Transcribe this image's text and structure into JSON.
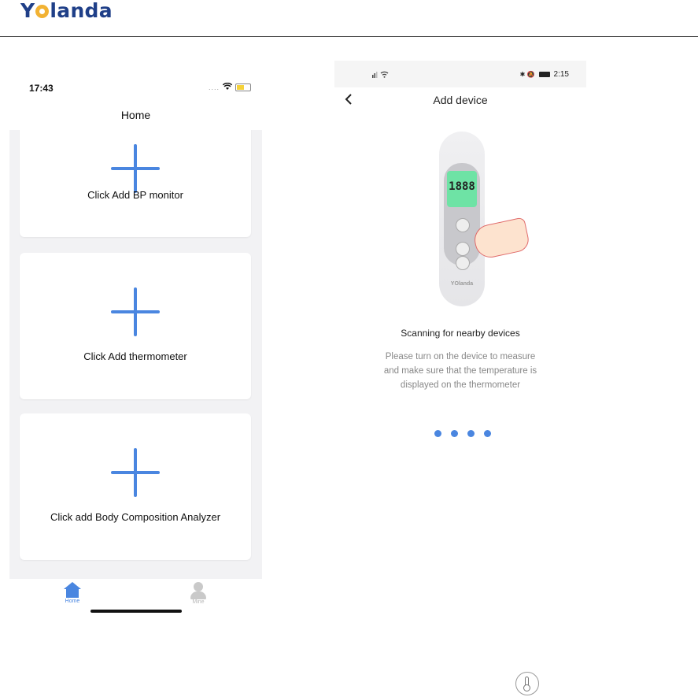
{
  "brand": {
    "left": "Y",
    "right": "landa"
  },
  "left_phone": {
    "status": {
      "time": "17:43",
      "dots": "....",
      "wifi": "wifi-icon",
      "battery": "battery-icon"
    },
    "title": "Home",
    "cards": [
      {
        "label": "Click Add BP monitor"
      },
      {
        "label": "Click Add thermometer"
      },
      {
        "label": "Click add Body Composition Analyzer"
      }
    ],
    "tabs": [
      {
        "label": "Home",
        "icon": "home-icon",
        "active": true
      },
      {
        "label": "Mine",
        "icon": "person-icon",
        "active": false
      }
    ],
    "accent_color": "#4a86e0"
  },
  "right_phone": {
    "status": {
      "time": "2:15",
      "icons": "✱ 🔕"
    },
    "title": "Add device",
    "device": {
      "lcd": "1888",
      "brand": "YOlanda"
    },
    "scan_title": "Scanning for nearby devices",
    "scan_desc": "Please turn on the device to measure and make sure that the temperature is displayed on the thermometer",
    "dots_count": 4
  },
  "footer_icon": "thermometer-icon"
}
